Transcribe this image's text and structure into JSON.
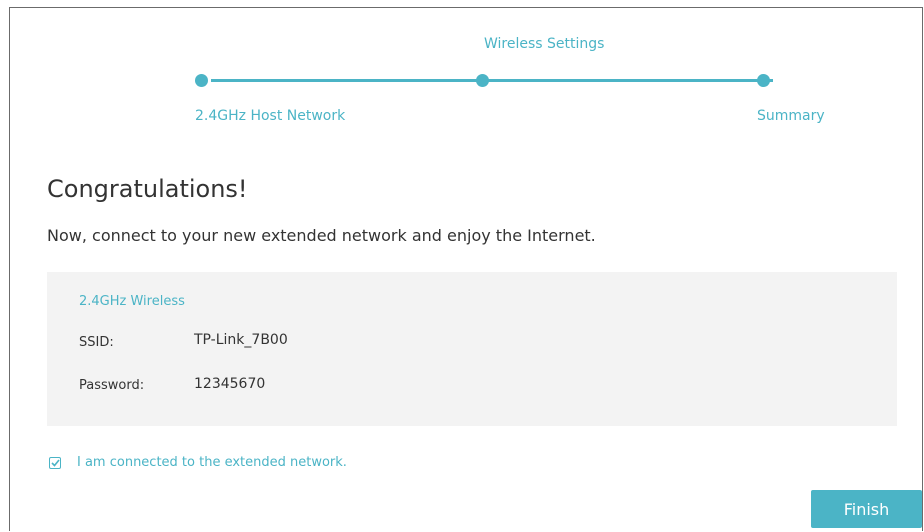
{
  "progress": {
    "current_step": "Wireless Settings",
    "steps": [
      "2.4GHz Host Network",
      "Wireless Settings",
      "Summary"
    ],
    "completed_fraction": 1.0
  },
  "heading": "Congratulations!",
  "message": "Now, connect to your new extended network and enjoy the Internet.",
  "wireless_panel": {
    "title": "2.4GHz Wireless",
    "ssid_label": "SSID:",
    "ssid_value": "TP-Link_7B00",
    "password_label": "Password:",
    "password_value": "12345670"
  },
  "confirm_checkbox": {
    "label": "I am connected to the extended network.",
    "checked": true
  },
  "finish_label": "Finish",
  "colors": {
    "accent": "#4bb4c6",
    "text": "#333333",
    "panel_bg": "#f3f3f3"
  }
}
